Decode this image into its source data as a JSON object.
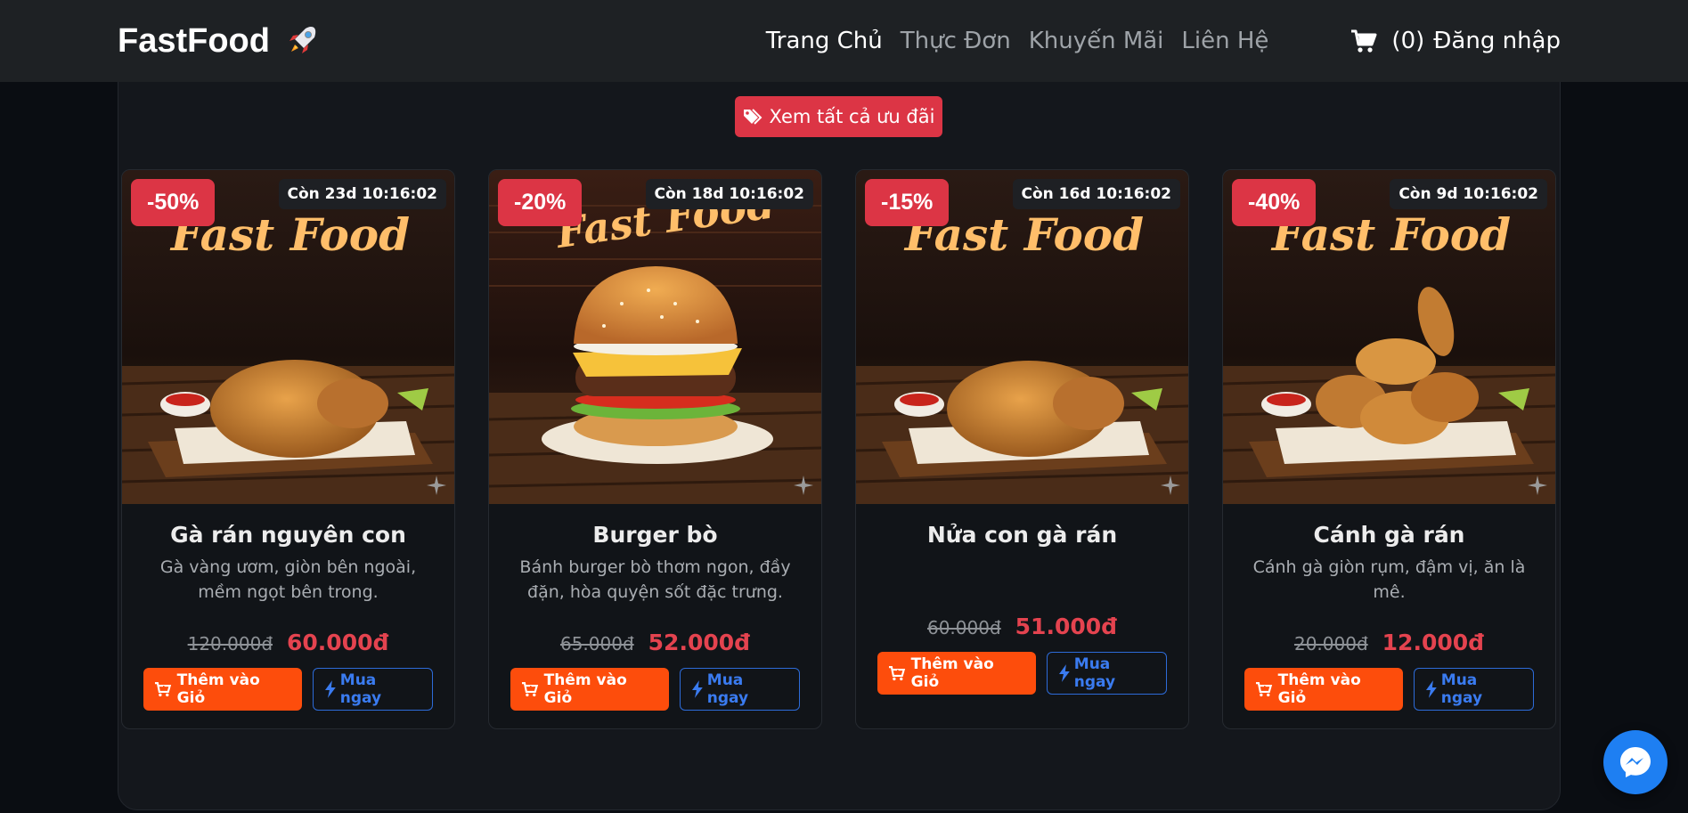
{
  "nav": {
    "brand": "FastFood",
    "links": [
      {
        "label": "Trang Chủ",
        "active": true
      },
      {
        "label": "Thực Đơn",
        "active": false
      },
      {
        "label": "Khuyến Mãi",
        "active": false
      },
      {
        "label": "Liên Hệ",
        "active": false
      }
    ],
    "cart_count": "(0)",
    "login": "Đăng nhập"
  },
  "promo_button": "Xem tất cả ưu đãi",
  "colors": {
    "accent_red": "#dc3545",
    "add_button": "#fd4d0c",
    "buy_button": "#2d6bd8",
    "price": "#e4434f"
  },
  "products": [
    {
      "name": "Gà rán nguyên con",
      "description": "Gà vàng ươm, giòn bên ngoài, mềm ngọt bên trong.",
      "discount": "-50%",
      "countdown": "Còn 23d 10:16:02",
      "old_price": "120.000đ",
      "new_price": "60.000đ",
      "add_label": "Thêm vào Giỏ",
      "buy_label": "Mua ngay",
      "image": "fried-chicken",
      "sign": "Fast Food"
    },
    {
      "name": "Burger bò",
      "description": "Bánh burger bò thơm ngon, đầy đặn, hòa quyện sốt đặc trưng.",
      "discount": "-20%",
      "countdown": "Còn 18d 10:16:02",
      "old_price": "65.000đ",
      "new_price": "52.000đ",
      "add_label": "Thêm vào Giỏ",
      "buy_label": "Mua ngay",
      "image": "burger",
      "sign": "Fast Food"
    },
    {
      "name": "Nửa con gà rán",
      "description": "",
      "discount": "-15%",
      "countdown": "Còn 16d 10:16:02",
      "old_price": "60.000đ",
      "new_price": "51.000đ",
      "add_label": "Thêm vào Giỏ",
      "buy_label": "Mua ngay",
      "image": "fried-chicken",
      "sign": "Fast Food"
    },
    {
      "name": "Cánh gà rán",
      "description": "Cánh gà giòn rụm, đậm vị, ăn là mê.",
      "discount": "-40%",
      "countdown": "Còn 9d 10:16:02",
      "old_price": "20.000đ",
      "new_price": "12.000đ",
      "add_label": "Thêm vào Giỏ",
      "buy_label": "Mua ngay",
      "image": "chicken-wings",
      "sign": "Fast Food"
    }
  ]
}
